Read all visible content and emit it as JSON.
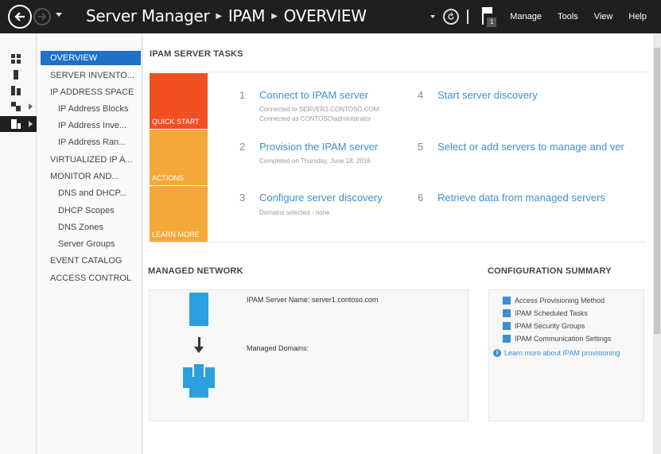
{
  "titlebar": {
    "breadcrumb": [
      "Server Manager",
      "IPAM",
      "OVERVIEW"
    ],
    "notifications_count": "1",
    "menu": [
      "Manage",
      "Tools",
      "View",
      "Help"
    ]
  },
  "nav": {
    "items": [
      "OVERVIEW",
      "SERVER INVENTO...",
      "IP ADDRESS SPACE",
      "IP Address Blocks",
      "IP Address Inve...",
      "IP Address Ran...",
      "VIRTUALIZED IP A...",
      "MONITOR AND...",
      "DNS and DHCP...",
      "DHCP Scopes",
      "DNS Zones",
      "Server Groups",
      "EVENT CATALOG",
      "ACCESS CONTROL"
    ]
  },
  "tasks": {
    "section_title": "IPAM SERVER TASKS",
    "tiles": [
      "QUICK START",
      "ACTIONS",
      "LEARN MORE"
    ],
    "tile_colors": [
      "#f04e23",
      "#f5a83a",
      "#f5a83a"
    ],
    "items": [
      {
        "num": "1",
        "label": "Connect to IPAM server",
        "sub1": "Connected to SERVER1.CONTOSO.COM",
        "sub2": "Connected as CONTOSO\\administrator"
      },
      {
        "num": "2",
        "label": "Provision the IPAM server",
        "sub1": "Completed on Thursday, June 18, 2016"
      },
      {
        "num": "3",
        "label": "Configure server discovery",
        "sub1": "Domains selected - none"
      },
      {
        "num": "4",
        "label": "Start server discovery"
      },
      {
        "num": "5",
        "label": "Select or add servers to manage and ver"
      },
      {
        "num": "6",
        "label": "Retrieve data from managed servers"
      }
    ]
  },
  "managed_network": {
    "title": "MANAGED NETWORK",
    "server_name": "IPAM Server Name: server1.contoso.com",
    "managed_domains": "Managed Domains:"
  },
  "config_summary": {
    "title": "CONFIGURATION SUMMARY",
    "items": [
      "Access Provisioning Method",
      "IPAM Scheduled Tasks",
      "IPAM Security Groups",
      "IPAM Communication Settings"
    ],
    "learn_more": "Learn more about IPAM provisioning"
  },
  "colors": {
    "accent": "#1e70c8",
    "link": "#3d8fd1",
    "titlebar": "#1f1f1f"
  }
}
